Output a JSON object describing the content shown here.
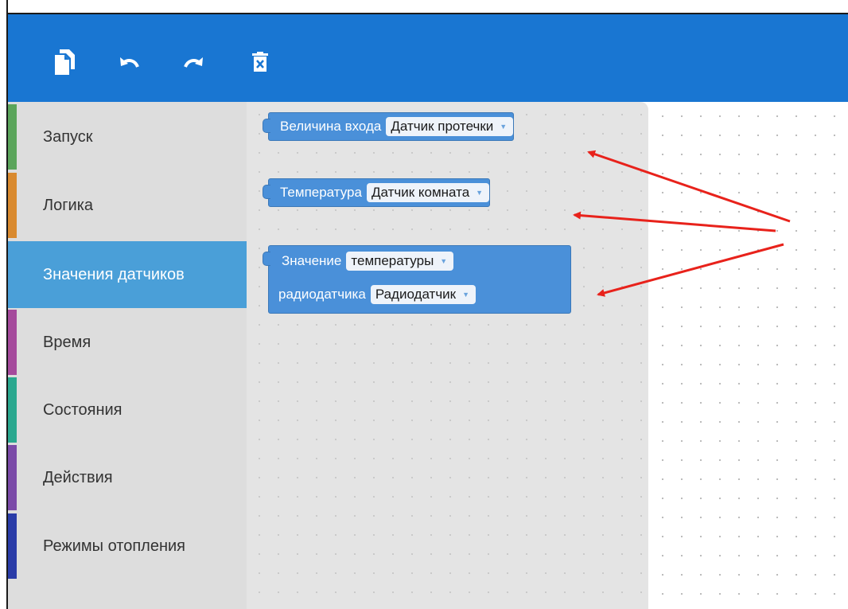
{
  "toolbar": {
    "buttons": [
      {
        "name": "copy",
        "icon": "copy-icon"
      },
      {
        "name": "undo",
        "icon": "undo-icon"
      },
      {
        "name": "redo",
        "icon": "redo-icon"
      },
      {
        "name": "delete",
        "icon": "trash-icon"
      }
    ],
    "color": "#1976d2"
  },
  "toolbox": {
    "selected_index": 2,
    "categories": [
      {
        "label": "Запуск",
        "color": "#5ba55b"
      },
      {
        "label": "Логика",
        "color": "#d98a2f"
      },
      {
        "label": "Значения датчиков",
        "color": "#4a9fd8"
      },
      {
        "label": "Время",
        "color": "#a54a9c"
      },
      {
        "label": "Состояния",
        "color": "#2aa88f"
      },
      {
        "label": "Действия",
        "color": "#7b4aa8"
      },
      {
        "label": "Режимы отопления",
        "color": "#2a3ca8"
      }
    ]
  },
  "blocks": [
    {
      "lines": [
        {
          "text": "Величина входа",
          "dropdown": "Датчик протечки"
        }
      ]
    },
    {
      "lines": [
        {
          "text": "Температура",
          "dropdown": "Датчик комната"
        }
      ]
    },
    {
      "lines": [
        {
          "text": "Значение",
          "dropdown": "температуры"
        },
        {
          "text": "радиодатчика",
          "dropdown": "Радиодатчик"
        }
      ]
    }
  ],
  "annotation": {
    "arrow_color": "#e8221b",
    "dropdown_caret": "▼"
  }
}
